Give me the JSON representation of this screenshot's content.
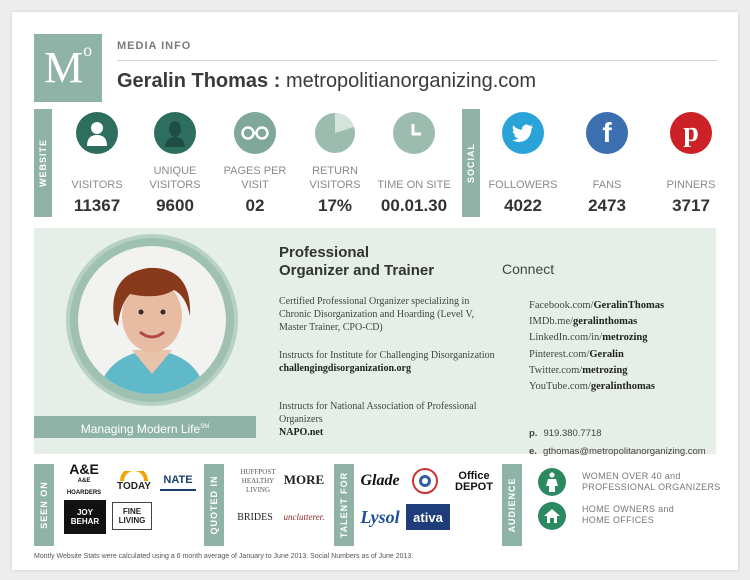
{
  "header": {
    "logo_letter": "M",
    "logo_super": "o",
    "section_label": "MEDIA INFO",
    "name": "Geralin Thomas :",
    "site": "metropolitianorganizing.com"
  },
  "website_bar": "WEBSITE",
  "social_bar": "SOCIAL",
  "website_stats": [
    {
      "icon": "single-person-icon",
      "label": "VISITORS",
      "value": "11367"
    },
    {
      "icon": "person-silhouette-icon",
      "label": "UNIQUE VISITORS",
      "value": "9600"
    },
    {
      "icon": "glasses-icon",
      "label": "PAGES PER VISIT",
      "value": "02"
    },
    {
      "icon": "pie-chart-icon",
      "label": "RETURN VISITORS",
      "value": "17%"
    },
    {
      "icon": "clock-icon",
      "label": "TIME ON SITE",
      "value": "00.01.30"
    }
  ],
  "social_stats": [
    {
      "icon": "twitter-bird-icon",
      "label": "FOLLOWERS",
      "value": "4022",
      "color": "#2aa3d8"
    },
    {
      "icon": "facebook-icon",
      "label": "FANS",
      "value": "2473",
      "color": "#3b6fb0"
    },
    {
      "icon": "pinterest-icon",
      "label": "PINNERS",
      "value": "3717",
      "color": "#cc2127"
    }
  ],
  "profile": {
    "tagline": "Managing Modern Life",
    "tagline_mark": "SM",
    "title_line1": "Professional",
    "title_line2": "Organizer and Trainer",
    "bio1": "Certified Professional Organizer specializing in Chronic Disorganization and Hoarding (Level V, Master Trainer, CPO-CD)",
    "bio2_text": "Instructs for Institute for Challenging Disorganization",
    "bio2_link": "challengingdisorganization.org",
    "bio3_text": "Instructs for National Association of Professional Organizers",
    "bio3_link": "NAPO.net"
  },
  "connect": {
    "title": "Connect",
    "links": [
      {
        "prefix": "Facebook.com/",
        "handle": "GeralinThomas"
      },
      {
        "prefix": "IMDb.me/",
        "handle": "geralinthomas"
      },
      {
        "prefix": "LinkedIn.com/in/",
        "handle": "metrozing"
      },
      {
        "prefix": "Pinterest.com/",
        "handle": "Geralin"
      },
      {
        "prefix": "Twitter.com/",
        "handle": "metrozing"
      },
      {
        "prefix": "YouTube.com/",
        "handle": "geralinthomas"
      }
    ],
    "phone_label": "p.",
    "phone": "919.380.7718",
    "email_label": "e.",
    "email": "gthomas@metropolitanorganizing.com"
  },
  "bottom": {
    "seen_on_label": "SEEN ON",
    "seen_on": [
      "A&E HOARDERS",
      "TODAY",
      "NATE",
      "JOY BEHAR",
      "FINE LIVING"
    ],
    "quoted_in_label": "QUOTED IN",
    "quoted_in": [
      "HUFFPOST HEALTHY LIVING",
      "MORE",
      "BRIDES",
      "unclutterer."
    ],
    "talent_for_label": "TALENT FOR",
    "talent_for": [
      "Glade",
      "Office DEPOT",
      "Lysol",
      "ativa"
    ],
    "audience_label": "AUDIENCE",
    "audience": [
      {
        "icon": "woman-icon",
        "text1": "WOMEN OVER 40 and",
        "text2": "PROFESSIONAL ORGANIZERS"
      },
      {
        "icon": "home-icon",
        "text1": "HOME OWNERS and",
        "text2": "HOME OFFICES"
      }
    ],
    "footnote": "Montly Website Stats were calculated using a 6 month average of January to June 2013.   Social Numbers as of June 2013."
  },
  "colors": {
    "accent": "#8fb3a6",
    "panel": "#e5eee7",
    "icon_teal": "#2e6e5f",
    "icon_gray": "#7fa79a",
    "audience_green": "#2b8a62"
  }
}
